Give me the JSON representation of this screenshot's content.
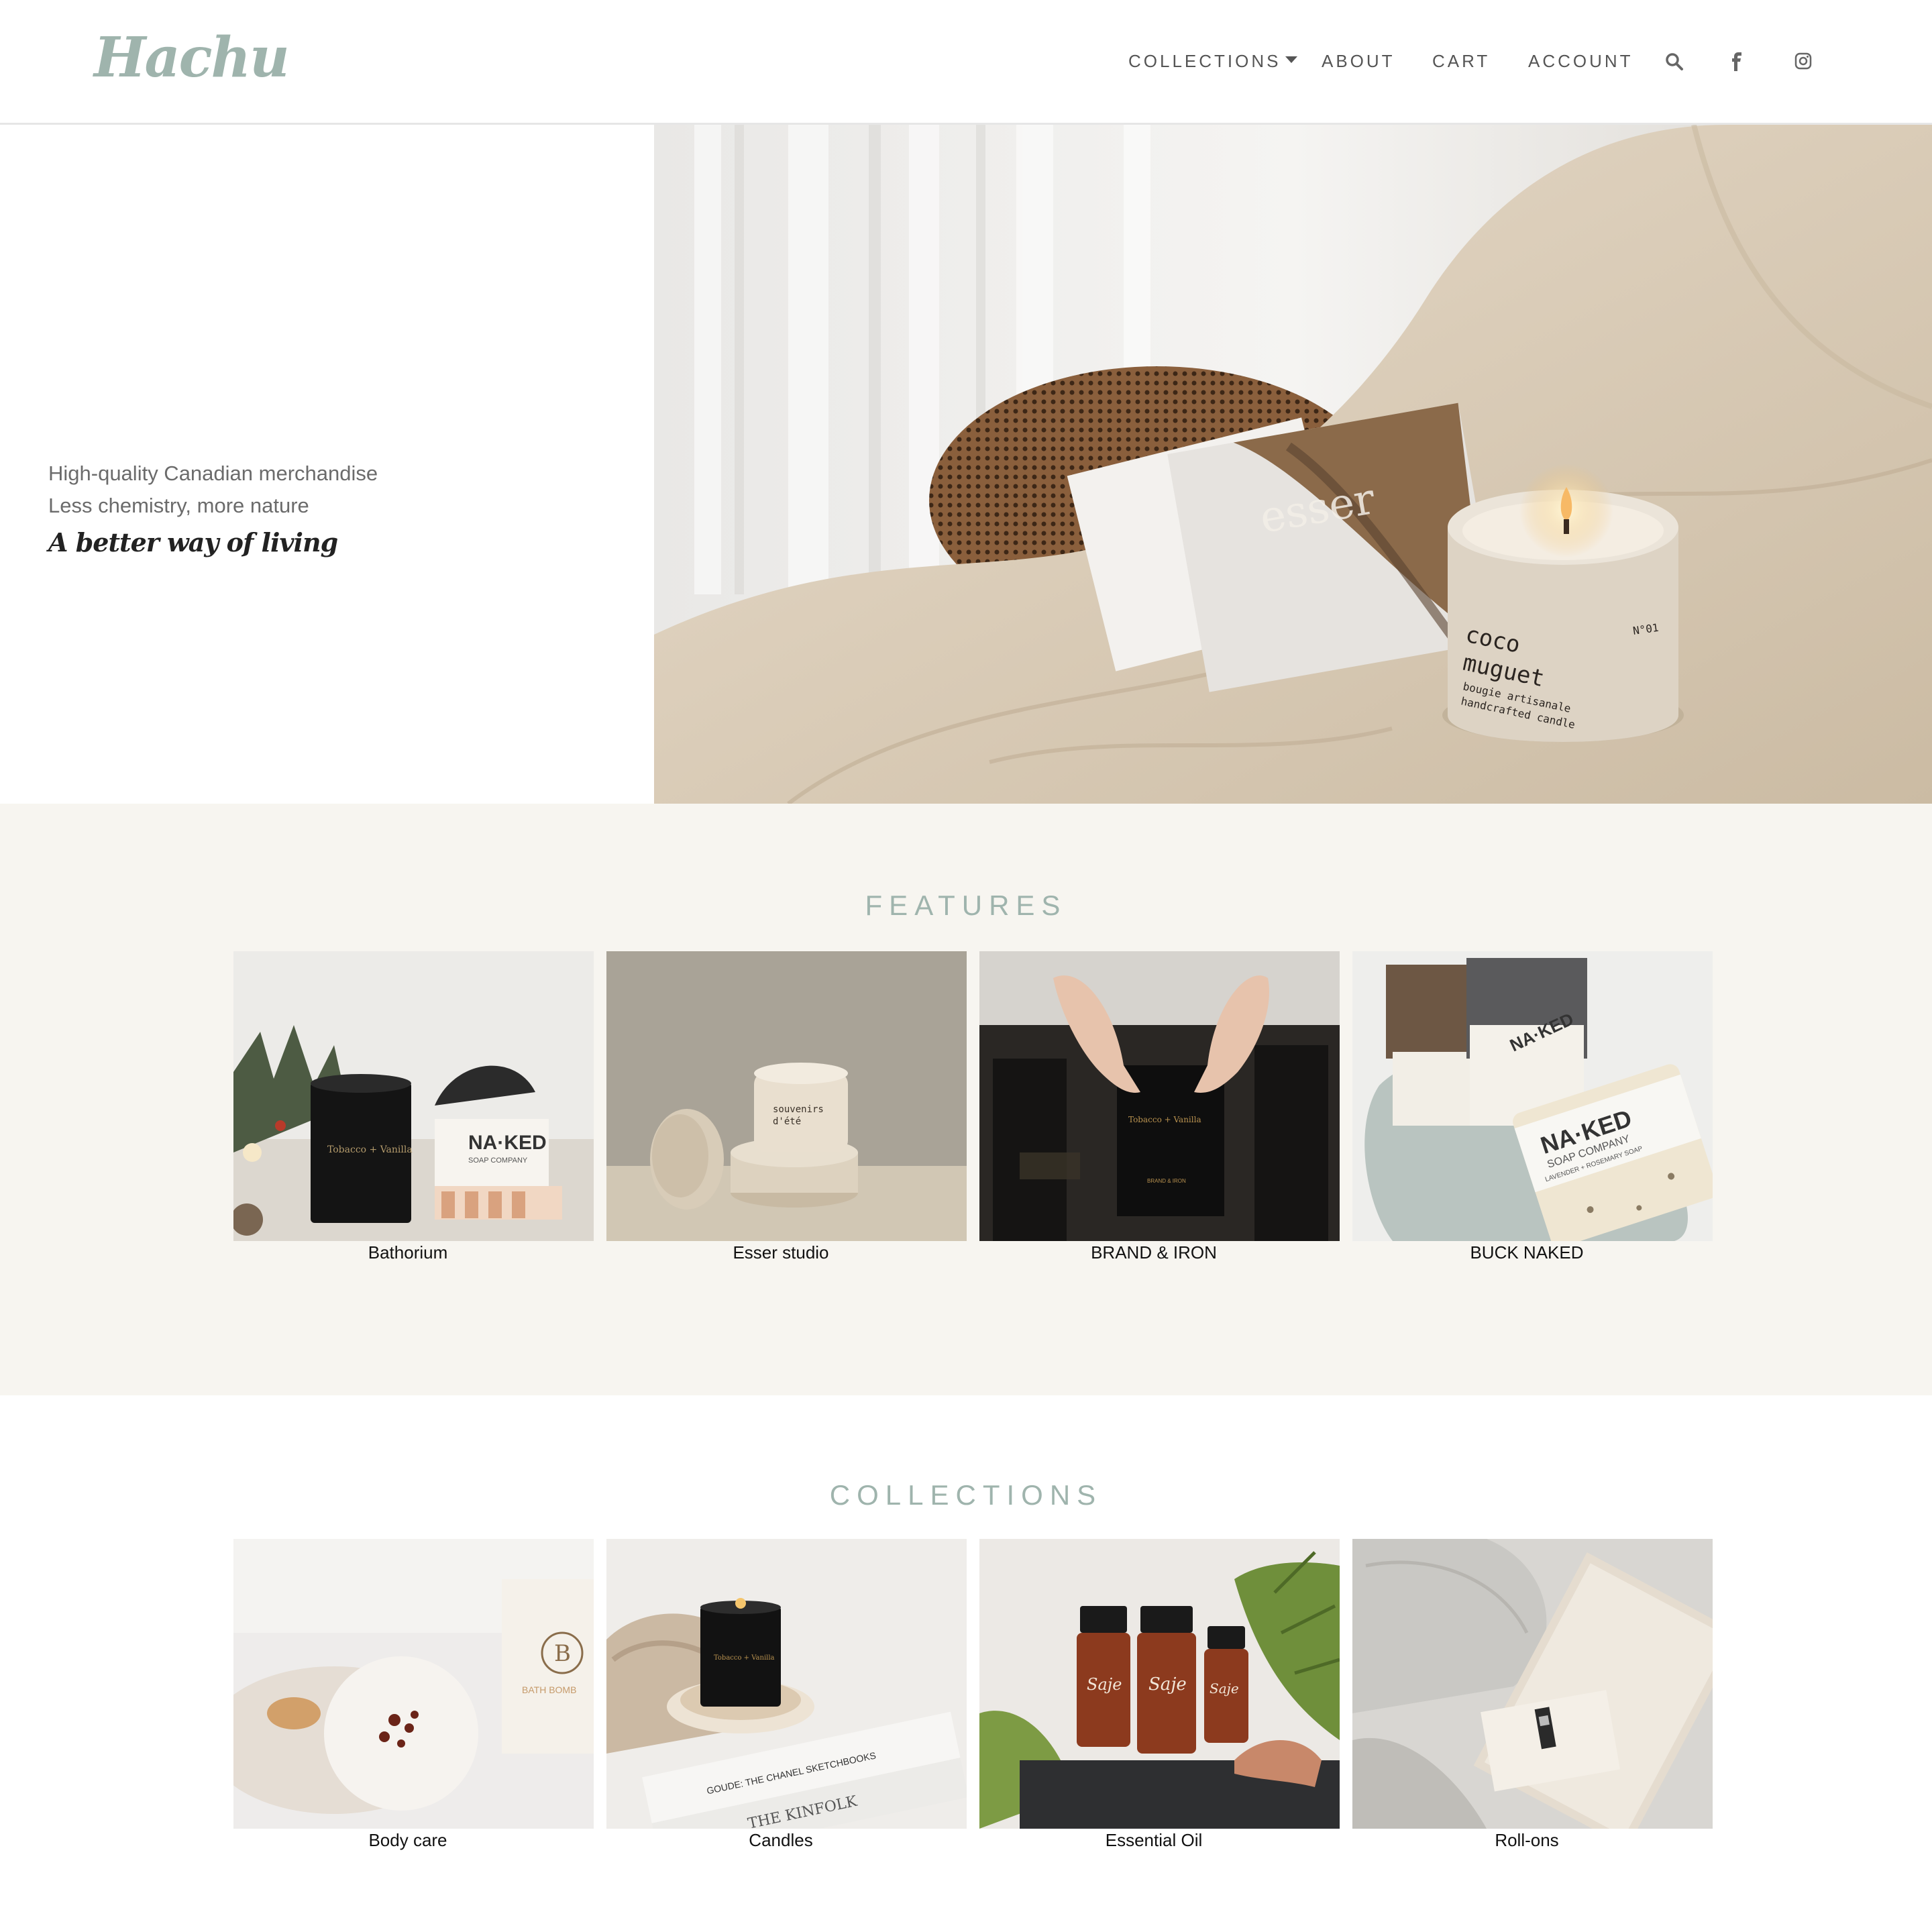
{
  "header": {
    "logo": "Hachu",
    "nav": {
      "collections": "COLLECTIONS",
      "about": "ABOUT",
      "cart": "CART",
      "account": "ACCOUNT"
    },
    "icons": [
      "search-icon",
      "facebook-icon",
      "instagram-icon"
    ]
  },
  "hero": {
    "tagline": "A better way of living",
    "line1": "High-quality Canadian merchandise",
    "line2": "Less chemistry, more nature"
  },
  "features": {
    "title": "FEATURES",
    "items": [
      {
        "label": "Bathorium"
      },
      {
        "label": "Esser studio"
      },
      {
        "label": "BRAND & IRON"
      },
      {
        "label": "BUCK NAKED"
      }
    ]
  },
  "collections": {
    "title": "COLLECTIONS",
    "items": [
      {
        "label": "Body care"
      },
      {
        "label": "Candles"
      },
      {
        "label": "Essential Oil"
      },
      {
        "label": "Roll-ons"
      }
    ]
  },
  "colors": {
    "accent": "#9fb4ad",
    "features_bg": "#f7f5f0",
    "text": "#555555"
  }
}
